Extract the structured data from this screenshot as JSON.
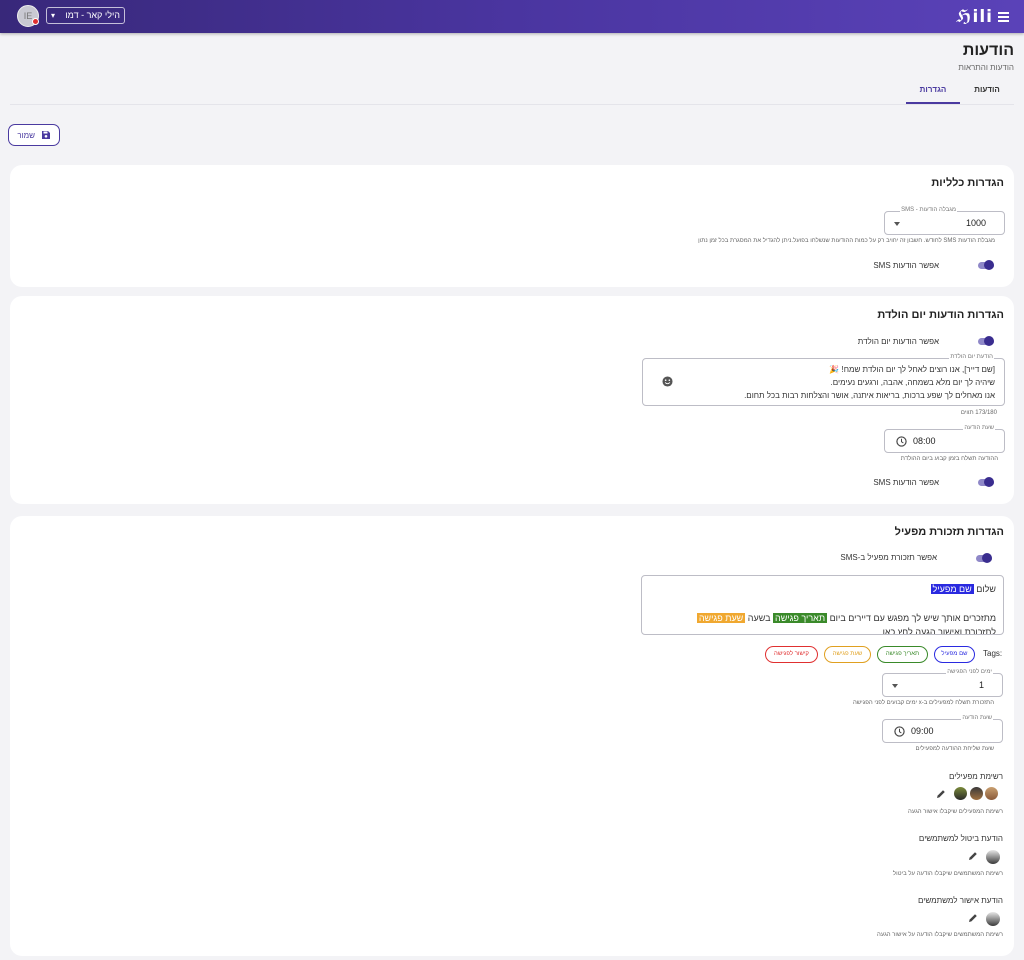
{
  "topbar": {
    "logo": "ℌili",
    "branch_label": "הילי קאר - דמו",
    "avatar_initials": "IE"
  },
  "header": {
    "title": "הודעות",
    "subtitle": "הודעות והתראות"
  },
  "tabs": [
    {
      "label": "הודעות",
      "active": false
    },
    {
      "label": "הגדרות",
      "active": true
    }
  ],
  "save_button": {
    "label": "שמור"
  },
  "general": {
    "title": "הגדרות כלליות",
    "sms_limit_label": "מגבלה הודעות - SMS",
    "sms_limit_value": "1000",
    "sms_limit_helper": "מגבלת הודעות SMS לחודש. חשבון זה יחויב רק על כמות ההודעות שנשלחו בפועל.ניתן להגדיל את המסגרת בכל זמן נתון",
    "enable_sms_label": "אפשר הודעות SMS",
    "enable_sms_on": true
  },
  "birthday": {
    "title": "הגדרות הודעות יום הולדת",
    "enable_label": "אפשר הודעות יום הולדת",
    "enable_on": true,
    "message_label": "הודעת יום הולדת",
    "message_lines": [
      "[שם דייר], אנו רוצים לאחל לך יום הולדת שמח! 🎉",
      "שיהיה לך יום מלא בשמחה, אהבה, ורגעים נעימים.",
      "אנו מאחלים לך שפע ברכות, בריאות איתנה, אושר והצלחות רבות בכל תחום."
    ],
    "char_count": "173/180 תווים",
    "time_label": "שעת הודעה",
    "time_value": "08:00",
    "time_helper": "ההודעה תשלח בזמן קבוע ביום ההולדת",
    "enable_sms_label": "אפשר הודעות SMS",
    "enable_sms_on": true
  },
  "reminder": {
    "title": "הגדרות תזכורת מפעיל",
    "enable_label": "אפשר תזכורת מפעיל ב-SMS",
    "enable_on": true,
    "msg_greeting": "שלום",
    "msg_tag_name": "שם מפעיל",
    "msg_line2_a": "מתזכרים אותך שיש לך מפגש עם דיירים ביום",
    "msg_tag_date": "תאריך פגישה",
    "msg_line2_b": "בשעה",
    "msg_tag_time": "שעת פגישה",
    "msg_line3": "לתזכורת ואישור הגעה לחץ כאן",
    "tags_label": "Tags:",
    "tags": [
      {
        "label": "שם מפעיל",
        "color": "#2a2ae0"
      },
      {
        "label": "תאריך פגישה",
        "color": "#3a8a2a"
      },
      {
        "label": "שעת פגישה",
        "color": "#e0a020"
      },
      {
        "label": "קישור לפגישה",
        "color": "#e03030"
      }
    ],
    "days_label": "ימים לפני הפגישה",
    "days_value": "1",
    "days_helper": "התזכורת תשלח למפעילים ב-x ימים קבועים לפני הפגישה",
    "time_label": "שעת הודעה",
    "time_value": "09:00",
    "time_helper": "שעת שליחת ההודעה למפעילים",
    "operators_title": "רשימת מפעילים",
    "operators_helper": "רשימת המפעילים שיקבלו אישור הגעה",
    "cancel_title": "הודעת ביטול למשתמשים",
    "cancel_helper": "רשימת המשתמשים שיקבלו הודעה על ביטול",
    "confirm_title": "הודעת אישור למשתמשים",
    "confirm_helper": "רשימת המשתמשים שיקבלו הודעה על אישור הגעה"
  },
  "colors": {
    "primary": "#4a3aa0",
    "topbar": "#3f2f8c"
  }
}
